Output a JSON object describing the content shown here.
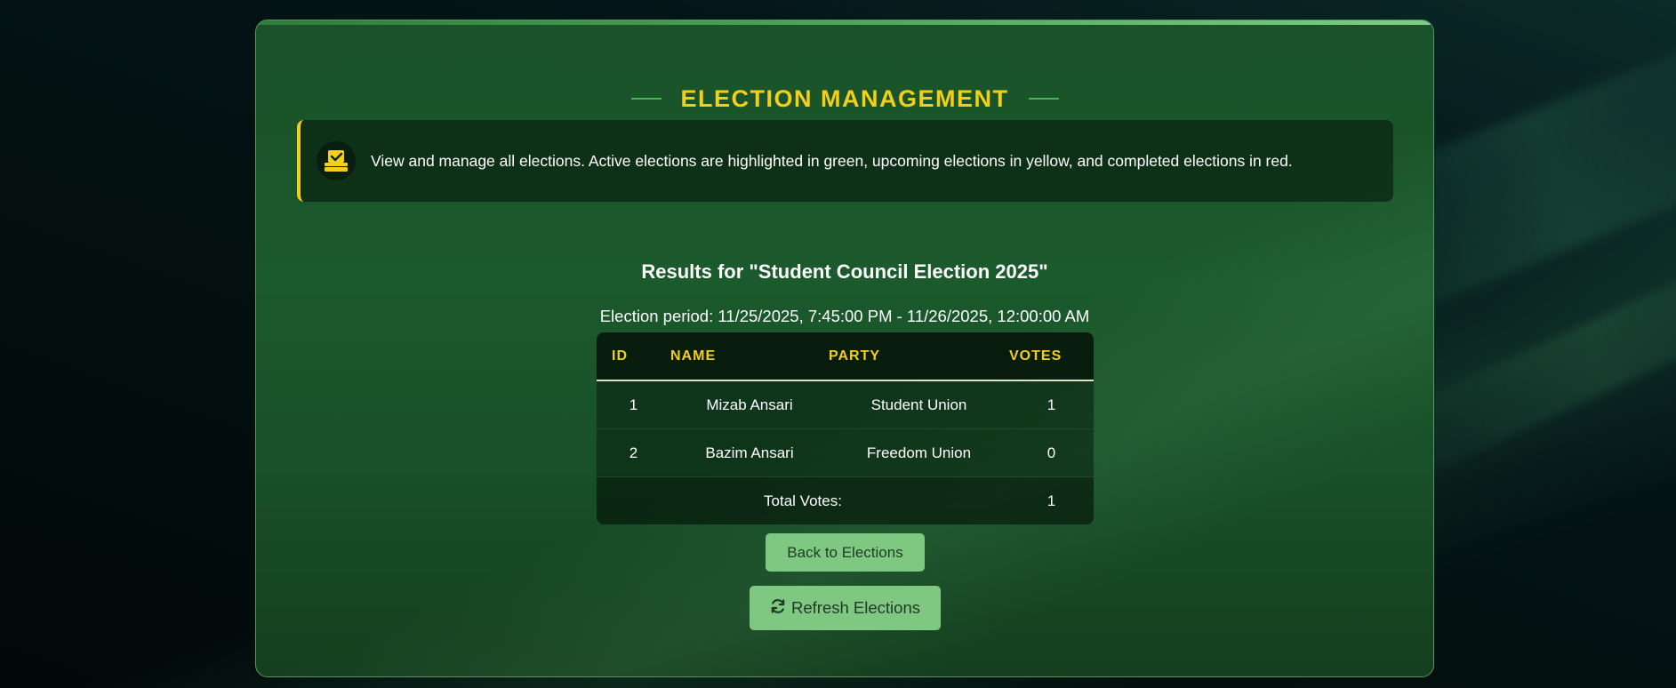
{
  "page": {
    "title": "ELECTION MANAGEMENT",
    "info_text": "View and manage all elections. Active elections are highlighted in green, upcoming elections in yellow, and completed elections in red.",
    "info_icon": "ballot-box-icon"
  },
  "results": {
    "heading": "Results for \"Student Council Election 2025\"",
    "period": "Election period: 11/25/2025, 7:45:00 PM - 11/26/2025, 12:00:00 AM",
    "columns": [
      "ID",
      "NAME",
      "PARTY",
      "VOTES"
    ],
    "rows": [
      {
        "id": "1",
        "name": "Mizab Ansari",
        "party": "Student Union",
        "votes": "1"
      },
      {
        "id": "2",
        "name": "Bazim Ansari",
        "party": "Freedom Union",
        "votes": "0"
      }
    ],
    "total_label": "Total Votes:",
    "total_value": "1"
  },
  "buttons": {
    "back_label": "Back to Elections",
    "refresh_label": "Refresh Elections",
    "refresh_icon": "refresh-icon"
  },
  "colors": {
    "accent_yellow": "#f4cf17",
    "button_green": "#7fc882",
    "card_green": "#1a5229"
  }
}
